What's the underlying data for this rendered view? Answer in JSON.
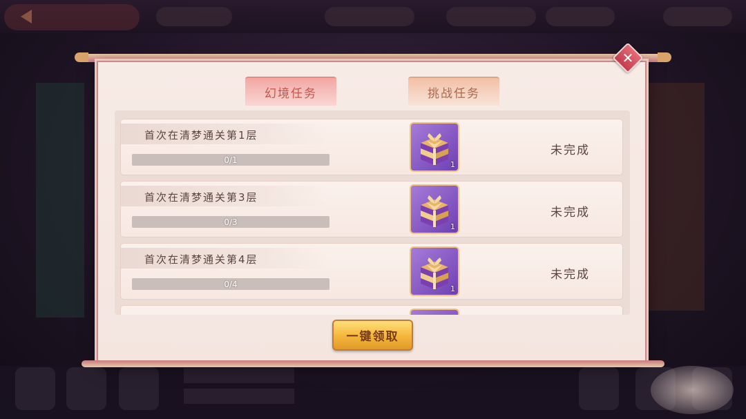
{
  "dialog": {
    "close_icon": "close-icon",
    "tabs": [
      {
        "label": "幻境任务",
        "active": true
      },
      {
        "label": "挑战任务",
        "active": false
      }
    ],
    "tasks": [
      {
        "title": "首次在清梦通关第1层",
        "progress_text": "0/1",
        "progress": 0,
        "reward_icon": "gift-box-icon",
        "reward_count": "1",
        "status": "未完成"
      },
      {
        "title": "首次在清梦通关第3层",
        "progress_text": "0/3",
        "progress": 0,
        "reward_icon": "gift-box-icon",
        "reward_count": "1",
        "status": "未完成"
      },
      {
        "title": "首次在清梦通关第4层",
        "progress_text": "0/4",
        "progress": 0,
        "reward_icon": "gift-box-icon",
        "reward_count": "1",
        "status": "未完成"
      }
    ],
    "claim_all_label": "一键领取"
  },
  "colors": {
    "dialog_bg": "#f4e5df",
    "active_tab": "#f3a7a2",
    "reward_bg": "#6e40b2",
    "claim_button": "#f5b53a"
  }
}
